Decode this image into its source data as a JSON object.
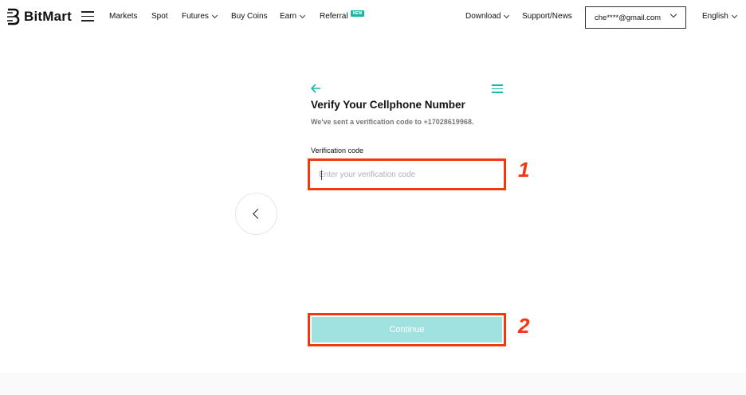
{
  "header": {
    "logo_text": "BitMart",
    "nav": [
      {
        "label": "Markets",
        "dropdown": false
      },
      {
        "label": "Spot",
        "dropdown": false
      },
      {
        "label": "Futures",
        "dropdown": true
      },
      {
        "label": "Buy Coins",
        "dropdown": false
      },
      {
        "label": "Earn",
        "dropdown": true
      },
      {
        "label": "Referral",
        "dropdown": false,
        "badge": "NEW"
      }
    ],
    "download": "Download",
    "support": "Support/News",
    "account": "che****@gmail.com",
    "language": "English"
  },
  "form": {
    "title": "Verify Your Cellphone Number",
    "subtitle": "We've sent a verification code to +17028619968.",
    "field_label": "Verification code",
    "input_value": "",
    "input_placeholder": "Enter your verification code",
    "continue_label": "Continue"
  },
  "annotations": [
    "1",
    "2"
  ],
  "colors": {
    "accent": "#1fb6a8",
    "button_disabled": "#a0e2df",
    "annotation": "#f2380f",
    "badge": "#21b3a5"
  }
}
